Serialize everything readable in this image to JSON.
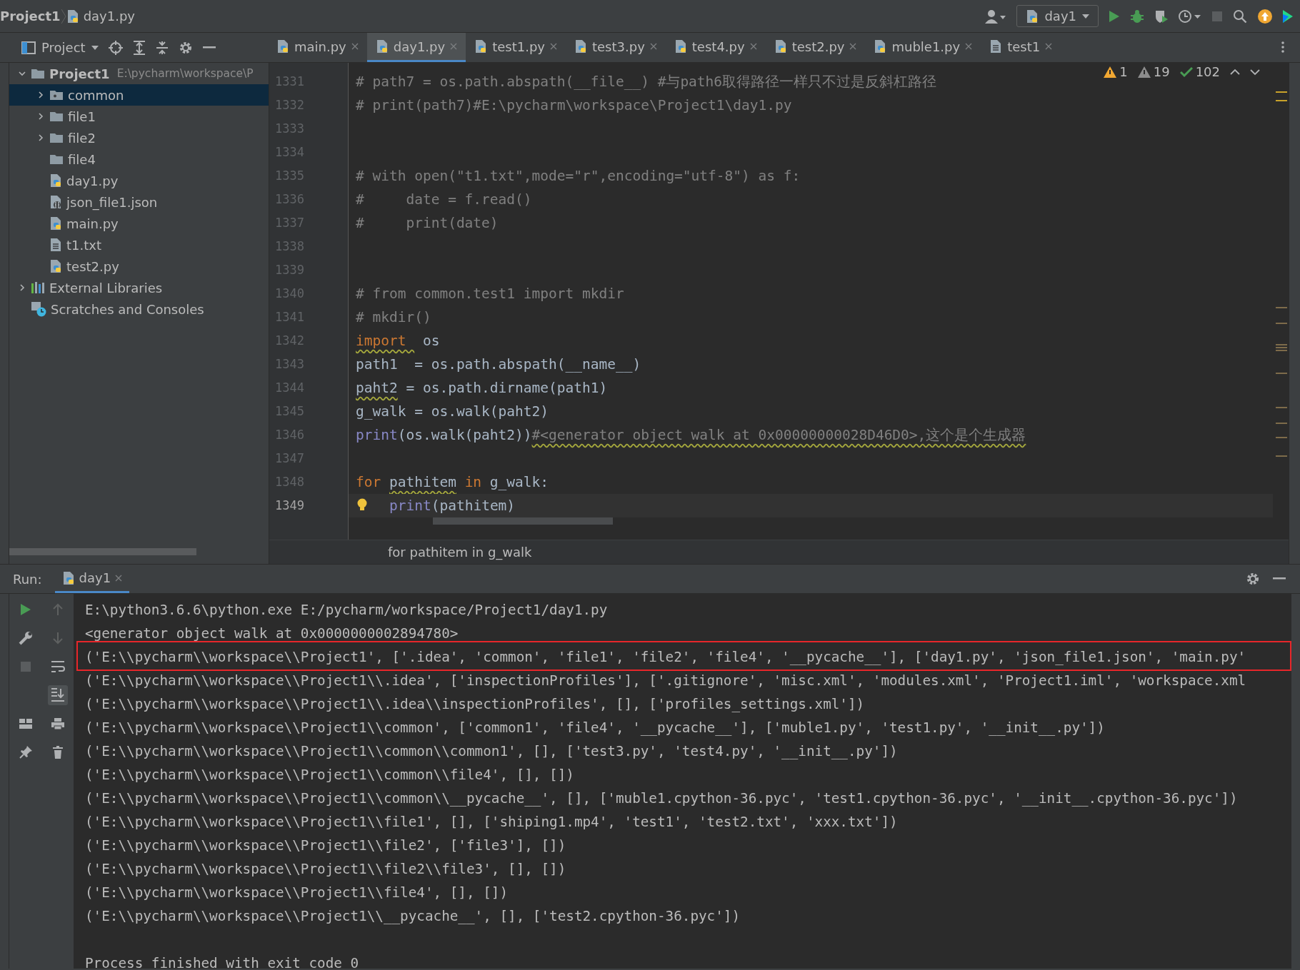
{
  "navbar": {
    "breadcrumbs": [
      {
        "label": "Project1",
        "kind": "project"
      },
      {
        "label": "day1.py",
        "kind": "python"
      }
    ],
    "run_config": "day1"
  },
  "project_panel": {
    "title": "Project",
    "tree": [
      {
        "label": "Project1",
        "path": "E:\\pycharm\\workspace\\P",
        "kind": "root",
        "expanded": true,
        "selected": false,
        "children": [
          {
            "label": "common",
            "kind": "package",
            "expanded": false,
            "selected": true
          },
          {
            "label": "file1",
            "kind": "folder",
            "expanded": false,
            "selected": false
          },
          {
            "label": "file2",
            "kind": "folder",
            "expanded": false,
            "selected": false
          },
          {
            "label": "file4",
            "kind": "folder",
            "selected": false
          },
          {
            "label": "day1.py",
            "kind": "python",
            "selected": false
          },
          {
            "label": "json_file1.json",
            "kind": "json",
            "selected": false
          },
          {
            "label": "main.py",
            "kind": "python",
            "selected": false
          },
          {
            "label": "t1.txt",
            "kind": "text",
            "selected": false
          },
          {
            "label": "test2.py",
            "kind": "python",
            "selected": false
          }
        ]
      },
      {
        "label": "External Libraries",
        "kind": "libraries",
        "expanded": false,
        "selected": false
      },
      {
        "label": "Scratches and Consoles",
        "kind": "scratches",
        "selected": false
      }
    ]
  },
  "tabs": [
    {
      "label": "main.py",
      "kind": "python",
      "selected": false
    },
    {
      "label": "day1.py",
      "kind": "python",
      "selected": true
    },
    {
      "label": "test1.py",
      "kind": "python",
      "selected": false
    },
    {
      "label": "test3.py",
      "kind": "python",
      "selected": false
    },
    {
      "label": "test4.py",
      "kind": "python",
      "selected": false
    },
    {
      "label": "test2.py",
      "kind": "python",
      "selected": false
    },
    {
      "label": "muble1.py",
      "kind": "python",
      "selected": false
    },
    {
      "label": "test1",
      "kind": "text",
      "selected": false
    }
  ],
  "inspections": [
    {
      "kind": "warning",
      "count": "1"
    },
    {
      "kind": "weak_warning",
      "count": "19"
    },
    {
      "kind": "ok",
      "count": "102"
    }
  ],
  "editor": {
    "lines": [
      {
        "number": "1331",
        "current": false,
        "segments": [
          {
            "t": "# path7 = os.path.abspath(__file__) #与path6取得路径一样只不过是反斜杠路径",
            "kind": "comment",
            "warn": false
          }
        ]
      },
      {
        "number": "1332",
        "current": false,
        "segments": [
          {
            "t": "# print(path7)#E:\\pycharm\\workspace\\Project1\\day1.py",
            "kind": "comment",
            "warn": false
          }
        ]
      },
      {
        "number": "1333",
        "current": false
      },
      {
        "number": "1334",
        "current": false
      },
      {
        "number": "1335",
        "current": false,
        "segments": [
          {
            "t": "# with open(\"t1.txt\",mode=\"r\",encoding=\"utf-8\") as f:",
            "kind": "comment",
            "warn": false
          }
        ]
      },
      {
        "number": "1336",
        "current": false,
        "segments": [
          {
            "t": "#     date = f.read()",
            "kind": "comment",
            "warn": false
          }
        ]
      },
      {
        "number": "1337",
        "current": false,
        "segments": [
          {
            "t": "#     print(date)",
            "kind": "comment",
            "warn": false
          }
        ]
      },
      {
        "number": "1338",
        "current": false
      },
      {
        "number": "1339",
        "current": false
      },
      {
        "number": "1340",
        "current": false,
        "segments": [
          {
            "t": "# from common.test1 import mkdir",
            "kind": "comment",
            "warn": false
          }
        ]
      },
      {
        "number": "1341",
        "current": false,
        "segments": [
          {
            "t": "# mkdir()",
            "kind": "comment",
            "warn": false
          }
        ]
      },
      {
        "number": "1342",
        "current": false,
        "segments": [
          {
            "t": "import ",
            "kind": "keyword",
            "warn": true
          },
          {
            "t": " os",
            "kind": "plain",
            "warn": false
          }
        ]
      },
      {
        "number": "1343",
        "current": false,
        "segments": [
          {
            "t": "path1",
            "kind": "plain",
            "warn": false
          },
          {
            "t": "  = os.path.abspath(__name__)",
            "kind": "plain",
            "warn": false
          }
        ]
      },
      {
        "number": "1344",
        "current": false,
        "segments": [
          {
            "t": "paht2",
            "kind": "plain",
            "warn": true
          },
          {
            "t": " = os.path.dirname(path1)",
            "kind": "plain",
            "warn": false
          }
        ]
      },
      {
        "number": "1345",
        "current": false,
        "segments": [
          {
            "t": "g_walk = os.walk(paht2)",
            "kind": "plain",
            "warn": false
          }
        ]
      },
      {
        "number": "1346",
        "current": false,
        "segments": [
          {
            "t": "print",
            "kind": "builtin",
            "warn": false
          },
          {
            "t": "(os.walk(paht2))",
            "kind": "plain",
            "warn": false
          },
          {
            "t": "#<generator object walk at 0x00000000028D46D0>,这个是个生成器",
            "kind": "comment",
            "warn": true
          }
        ]
      },
      {
        "number": "1347",
        "current": false
      },
      {
        "number": "1348",
        "current": false,
        "segments": [
          {
            "t": "for ",
            "kind": "keyword",
            "warn": false
          },
          {
            "t": "pathitem",
            "kind": "plain",
            "warn": true
          },
          {
            "t": " in ",
            "kind": "keyword",
            "warn": false
          },
          {
            "t": "g_walk:",
            "kind": "plain",
            "warn": false
          }
        ]
      },
      {
        "number": "1349",
        "current": true,
        "bulb": true,
        "segments": [
          {
            "t": "print",
            "kind": "builtin",
            "warn": false
          },
          {
            "t": "(pathitem)",
            "kind": "plain",
            "warn": false
          }
        ]
      }
    ],
    "breadcrumb": "for pathitem in g_walk"
  },
  "run_panel": {
    "label": "Run:",
    "tab": "day1",
    "output": [
      {
        "kind": "command",
        "highlighted": false,
        "text": "E:\\python3.6.6\\python.exe E:/pycharm/workspace/Project1/day1.py"
      },
      {
        "kind": "output",
        "highlighted": false,
        "text": "<generator object walk at 0x0000000002894780>"
      },
      {
        "kind": "output",
        "highlighted": true,
        "text": "('E:\\\\pycharm\\\\workspace\\\\Project1', ['.idea', 'common', 'file1', 'file2', 'file4', '__pycache__'], ['day1.py', 'json_file1.json', 'main.py'"
      },
      {
        "kind": "output",
        "highlighted": false,
        "text": "('E:\\\\pycharm\\\\workspace\\\\Project1\\\\.idea', ['inspectionProfiles'], ['.gitignore', 'misc.xml', 'modules.xml', 'Project1.iml', 'workspace.xml"
      },
      {
        "kind": "output",
        "highlighted": false,
        "text": "('E:\\\\pycharm\\\\workspace\\\\Project1\\\\.idea\\\\inspectionProfiles', [], ['profiles_settings.xml'])"
      },
      {
        "kind": "output",
        "highlighted": false,
        "text": "('E:\\\\pycharm\\\\workspace\\\\Project1\\\\common', ['common1', 'file4', '__pycache__'], ['muble1.py', 'test1.py', '__init__.py'])"
      },
      {
        "kind": "output",
        "highlighted": false,
        "text": "('E:\\\\pycharm\\\\workspace\\\\Project1\\\\common\\\\common1', [], ['test3.py', 'test4.py', '__init__.py'])"
      },
      {
        "kind": "output",
        "highlighted": false,
        "text": "('E:\\\\pycharm\\\\workspace\\\\Project1\\\\common\\\\file4', [], [])"
      },
      {
        "kind": "output",
        "highlighted": false,
        "text": "('E:\\\\pycharm\\\\workspace\\\\Project1\\\\common\\\\__pycache__', [], ['muble1.cpython-36.pyc', 'test1.cpython-36.pyc', '__init__.cpython-36.pyc'])"
      },
      {
        "kind": "output",
        "highlighted": false,
        "text": "('E:\\\\pycharm\\\\workspace\\\\Project1\\\\file1', [], ['shiping1.mp4', 'test1', 'test2.txt', 'xxx.txt'])"
      },
      {
        "kind": "output",
        "highlighted": false,
        "text": "('E:\\\\pycharm\\\\workspace\\\\Project1\\\\file2', ['file3'], [])"
      },
      {
        "kind": "output",
        "highlighted": false,
        "text": "('E:\\\\pycharm\\\\workspace\\\\Project1\\\\file2\\\\file3', [], [])"
      },
      {
        "kind": "output",
        "highlighted": false,
        "text": "('E:\\\\pycharm\\\\workspace\\\\Project1\\\\file4', [], [])"
      },
      {
        "kind": "output",
        "highlighted": false,
        "text": "('E:\\\\pycharm\\\\workspace\\\\Project1\\\\__pycache__', [], ['test2.cpython-36.pyc'])"
      },
      {
        "kind": "exit",
        "highlighted": false,
        "text": "Process finished with exit code 0"
      }
    ]
  }
}
